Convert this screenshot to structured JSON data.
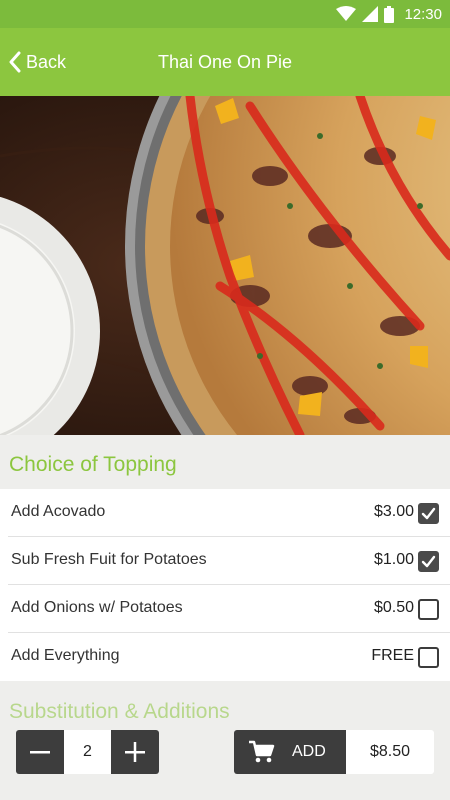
{
  "status_bar": {
    "time": "12:30"
  },
  "app_bar": {
    "back_label": "Back",
    "title": "Thai One On Pie"
  },
  "topping_section": {
    "heading": "Choice of Topping",
    "options": [
      {
        "label": "Add Acovado",
        "price": "$3.00",
        "checked": true
      },
      {
        "label": "Sub Fresh Fuit for Potatoes",
        "price": "$1.00",
        "checked": true
      },
      {
        "label": "Add Onions w/ Potatoes",
        "price": "$0.50",
        "checked": false
      },
      {
        "label": "Add Everything",
        "price": "FREE",
        "checked": false
      }
    ]
  },
  "substitution_section": {
    "heading": "Substitution & Additions"
  },
  "order_bar": {
    "quantity": "2",
    "add_label": "ADD",
    "total": "$8.50"
  },
  "colors": {
    "brand_green": "#8cc63f",
    "status_green": "#7cbb3c",
    "dark_button": "#3d3d3d"
  }
}
